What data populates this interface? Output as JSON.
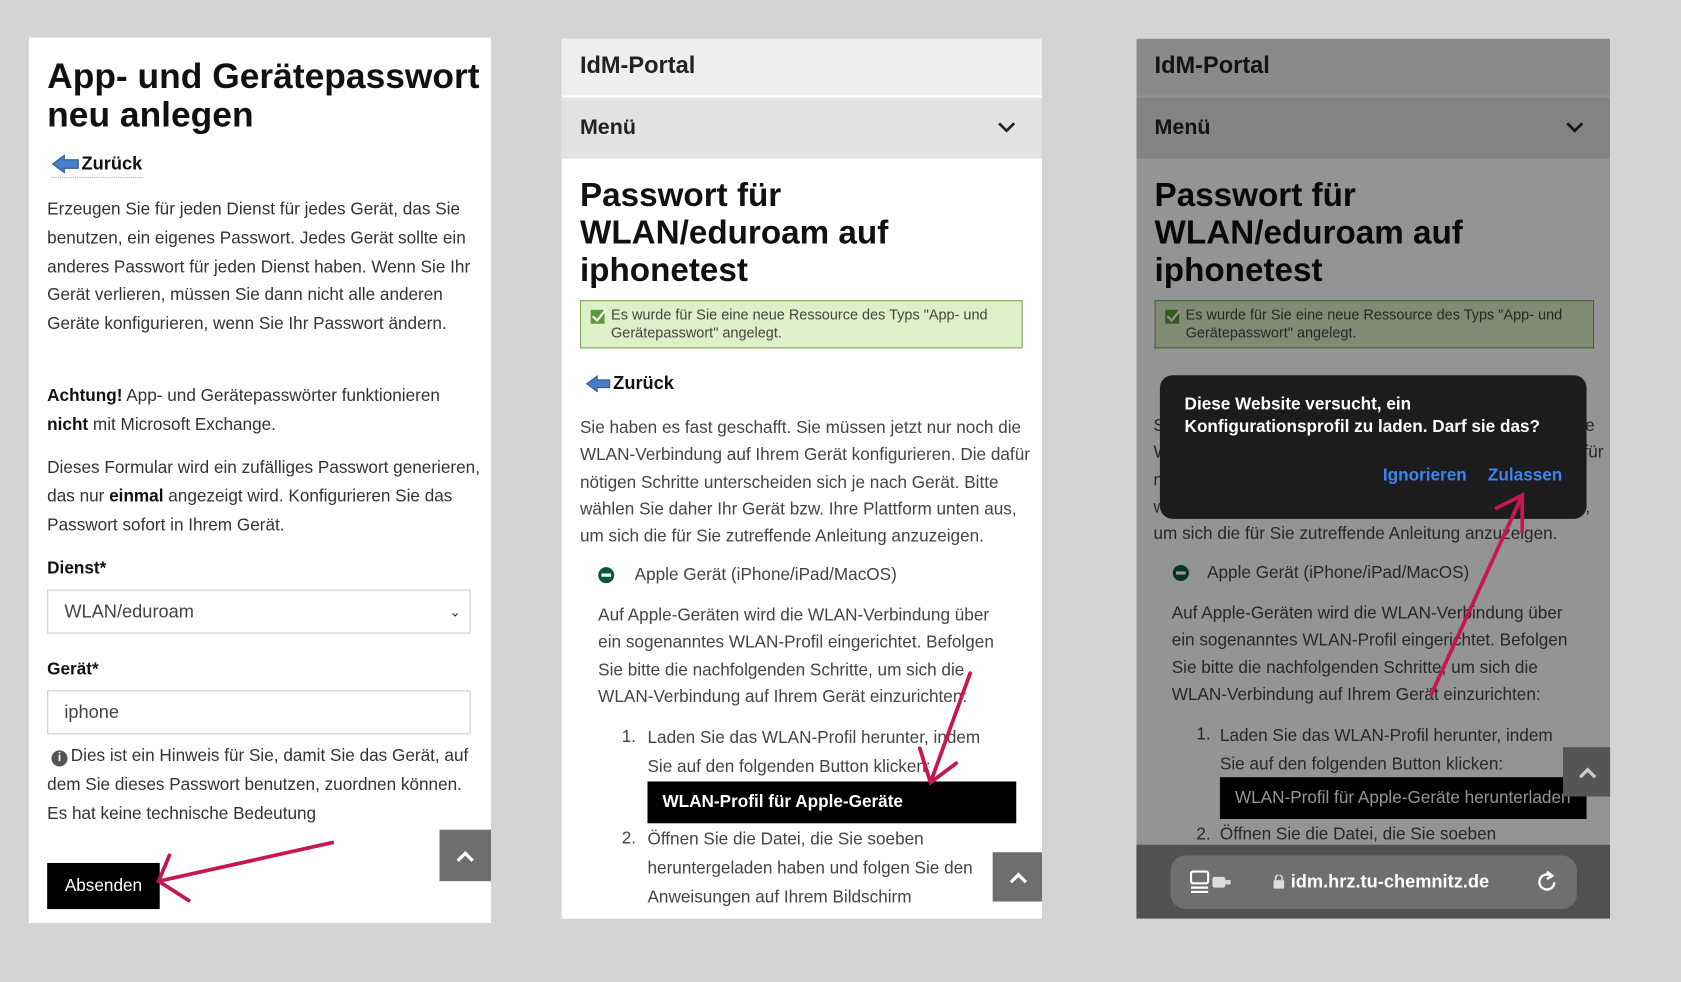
{
  "panel1": {
    "title": "App- und Gerätepasswort neu anlegen",
    "back": "Zurück",
    "intro": "Erzeugen Sie für jeden Dienst für jedes Gerät, das Sie benutzen, ein eigenes Passwort. Jedes Gerät sollte ein anderes Passwort für jeden Dienst haben. Wenn Sie Ihr Gerät verlieren, müssen Sie dann nicht alle anderen Geräte konfigurieren, wenn Sie Ihr Passwort ändern.",
    "warn_bold": "Achtung!",
    "warn_1": " App- und Gerätepasswörter funktionieren ",
    "warn_bold2": "nicht",
    "warn_2": " mit Microsoft Exchange.",
    "form_1": "Dieses Formular wird ein zufälliges Passwort generieren, das nur ",
    "form_bold": "einmal",
    "form_2": " angezeigt wird. Konfigurieren Sie das Passwort sofort in Ihrem Gerät.",
    "service_label": "Dienst*",
    "service_value": "WLAN/eduroam",
    "device_label": "Gerät*",
    "device_value": "iphone",
    "hint": "Dies ist ein Hinweis für Sie, damit Sie das Gerät, auf dem Sie dieses Passwort benutzen, zuordnen können. Es hat keine technische Bedeutung",
    "submit": "Absenden"
  },
  "portal": {
    "site": "IdM-Portal",
    "menu": "Menü",
    "title": "Passwort für WLAN/eduroam auf iphonetest",
    "success": "Es wurde für Sie eine neue Ressource des Typs \"App- und Gerätepasswort\" angelegt.",
    "back": "Zurück",
    "intro": "Sie haben es fast geschafft. Sie müssen jetzt nur noch die WLAN-Verbindung auf Ihrem Gerät konfigurieren. Die dafür nötigen Schritte unterscheiden sich je nach Gerät. Bitte wählen Sie daher Ihr Gerät bzw. Ihre Plattform unten aus, um sich die für Sie zutreffende Anleitung anzuzeigen.",
    "apple": "Apple Gerät (iPhone/iPad/MacOS)",
    "apple_text": "Auf Apple-Geräten wird die WLAN-Verbindung über ein sogenanntes WLAN-Profil eingerichtet. Befolgen Sie bitte die nachfolgenden Schritte, um sich die WLAN-Verbindung auf Ihrem Gerät einzurichten:",
    "step1": "Laden Sie das WLAN-Profil herunter, indem Sie auf den folgenden Button klicken:",
    "download": "WLAN-Profil für Apple-Geräte herunterladen",
    "step2": "Öffnen Sie die Datei, die Sie soeben heruntergeladen haben und folgen Sie den Anweisungen auf Ihrem Bildschirm",
    "step2_short": "Öffnen Sie die Datei, die Sie soeben"
  },
  "dialog": {
    "message": "Diese Website versucht, ein Konfigurationsprofil zu laden. Darf sie das?",
    "ignore": "Ignorieren",
    "allow": "Zulassen"
  },
  "browser": {
    "url": "idm.hrz.tu-chemnitz.de"
  },
  "colors": {
    "annotation_arrow": "#c8174e",
    "dialog_button": "#3a86f0",
    "success_bg": "#def0c8"
  }
}
